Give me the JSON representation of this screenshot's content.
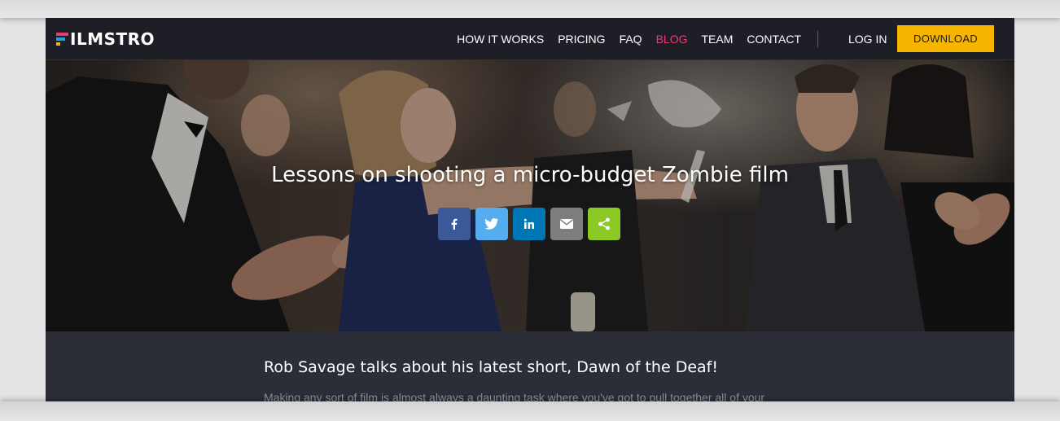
{
  "brand": {
    "logo_text": "ILMSTRO",
    "logo_colors": [
      "#e43f72",
      "#1fa3e0",
      "#f7b500"
    ]
  },
  "nav": {
    "items": [
      {
        "label": "HOW IT WORKS",
        "active": false
      },
      {
        "label": "PRICING",
        "active": false
      },
      {
        "label": "FAQ",
        "active": false
      },
      {
        "label": "BLOG",
        "active": true
      },
      {
        "label": "TEAM",
        "active": false
      },
      {
        "label": "CONTACT",
        "active": false
      }
    ],
    "login_label": "LOG IN",
    "download_label": "DOWNLOAD",
    "active_color": "#e43f72",
    "download_color": "#f7b500"
  },
  "hero": {
    "title": "Lessons on shooting a micro-budget Zombie film"
  },
  "share": {
    "buttons": [
      {
        "icon": "facebook-icon",
        "color": "#3b5998"
      },
      {
        "icon": "twitter-icon",
        "color": "#55acee"
      },
      {
        "icon": "linkedin-icon",
        "color": "#0077b5"
      },
      {
        "icon": "email-icon",
        "color": "#7d7d7d"
      },
      {
        "icon": "share-icon",
        "color": "#8ac926"
      }
    ]
  },
  "article": {
    "heading": "Rob Savage talks about his latest short, Dawn of the Deaf!",
    "excerpt": "Making any sort of film is almost always a daunting task where you've got to pull together all of your"
  }
}
